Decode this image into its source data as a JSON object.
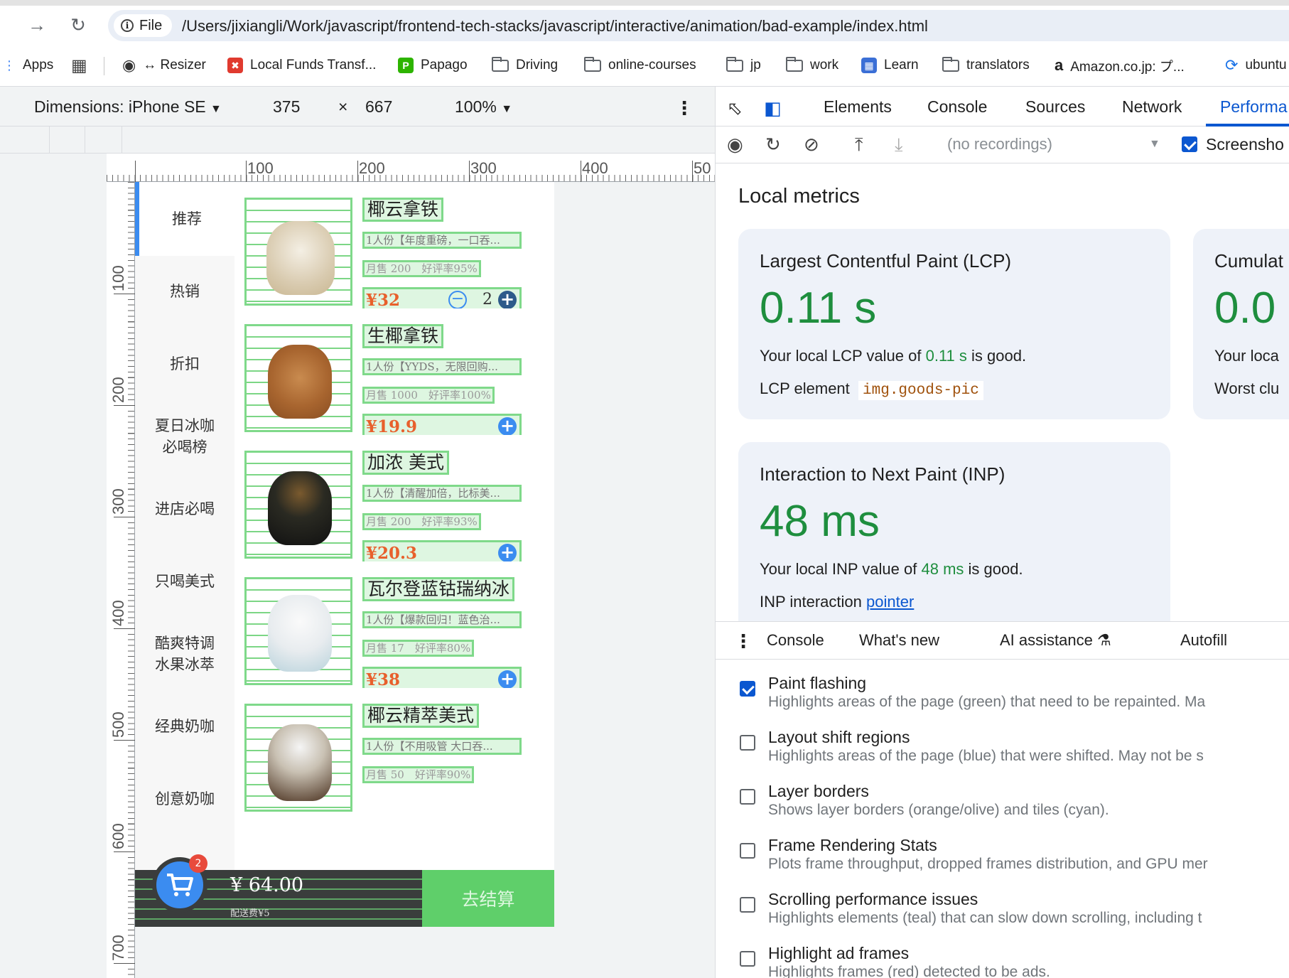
{
  "browser": {
    "url_chip": "File",
    "url": "/Users/jixiangli/Work/javascript/frontend-tech-stacks/javascript/interactive/animation/bad-example/index.html",
    "bookmarks": [
      "Apps",
      "Resizer",
      "Local Funds Transf...",
      "Papago",
      "Driving",
      "online-courses",
      "jp",
      "work",
      "Learn",
      "translators",
      "Amazon.co.jp: プ...",
      "ubuntu"
    ]
  },
  "device_toolbar": {
    "dimensions": "Dimensions: iPhone SE",
    "width": "375",
    "times": "×",
    "height": "667",
    "zoom": "100%"
  },
  "rulers": {
    "horizontal": [
      "100",
      "200",
      "300",
      "400",
      "50"
    ],
    "vertical": [
      "100",
      "200",
      "300",
      "400",
      "500",
      "600",
      "700"
    ]
  },
  "shop": {
    "categories": [
      "推荐",
      "热销",
      "折扣",
      "夏日冰咖\n必喝榜",
      "进店必喝",
      "只喝美式",
      "酷爽特调\n水果冰萃",
      "经典奶咖",
      "创意奶咖"
    ],
    "goods": [
      {
        "name": "椰云拿铁",
        "desc": "1人份【年度重磅，一口吞...",
        "sales": "月售 200　好评率95%",
        "price": "¥32",
        "qty": "2"
      },
      {
        "name": "生椰拿铁",
        "desc": "1人份【YYDS，无限回购...",
        "sales": "月售 1000　好评率100%",
        "price": "¥19.9",
        "qty": ""
      },
      {
        "name": "加浓 美式",
        "desc": "1人份【清醒加倍，比标美...",
        "sales": "月售 200　好评率93%",
        "price": "¥20.3",
        "qty": ""
      },
      {
        "name": "瓦尔登蓝钴瑞纳冰",
        "desc": "1人份【爆款回归！蓝色治...",
        "sales": "月售 17　好评率80%",
        "price": "¥38",
        "qty": ""
      },
      {
        "name": "椰云精萃美式",
        "desc": "1人份【不用吸管 大口吞...",
        "sales": "月售 50　好评率90%",
        "price": "",
        "qty": ""
      }
    ],
    "cart": {
      "badge": "2",
      "total": "¥ 64.00",
      "fee": "配送费¥5",
      "checkout": "去结算"
    }
  },
  "devtools": {
    "tabs": [
      "Elements",
      "Console",
      "Sources",
      "Network",
      "Performa"
    ],
    "recordings": "(no recordings)",
    "screenshots_label": "Screensho",
    "local_metrics": "Local metrics",
    "lcp": {
      "title": "Largest Contentful Paint (LCP)",
      "value": "0.11 s",
      "text_prefix": "Your local LCP value of ",
      "text_value": "0.11 s",
      "text_suffix": " is good.",
      "element_label": "LCP element",
      "element": "img.goods-pic"
    },
    "cls": {
      "title": "Cumulat",
      "value": "0.0",
      "text": "Your loca",
      "worst": "Worst clu"
    },
    "inp": {
      "title": "Interaction to Next Paint (INP)",
      "value": "48 ms",
      "text_prefix": "Your local INP value of ",
      "text_value": "48 ms",
      "text_suffix": " is good.",
      "interaction_label": "INP interaction",
      "interaction": "pointer"
    },
    "drawer_tabs": [
      "Console",
      "What's new",
      "AI assistance",
      "Autofill"
    ],
    "rendering": [
      {
        "name": "Paint flashing",
        "desc": "Highlights areas of the page (green) that need to be repainted. Ma",
        "checked": true
      },
      {
        "name": "Layout shift regions",
        "desc": "Highlights areas of the page (blue) that were shifted. May not be s",
        "checked": false
      },
      {
        "name": "Layer borders",
        "desc": "Shows layer borders (orange/olive) and tiles (cyan).",
        "checked": false
      },
      {
        "name": "Frame Rendering Stats",
        "desc": "Plots frame throughput, dropped frames distribution, and GPU mer",
        "checked": false
      },
      {
        "name": "Scrolling performance issues",
        "desc": "Highlights elements (teal) that can slow down scrolling, including t",
        "checked": false
      },
      {
        "name": "Highlight ad frames",
        "desc": "Highlights frames (red) detected to be ads.",
        "checked": false
      }
    ]
  }
}
